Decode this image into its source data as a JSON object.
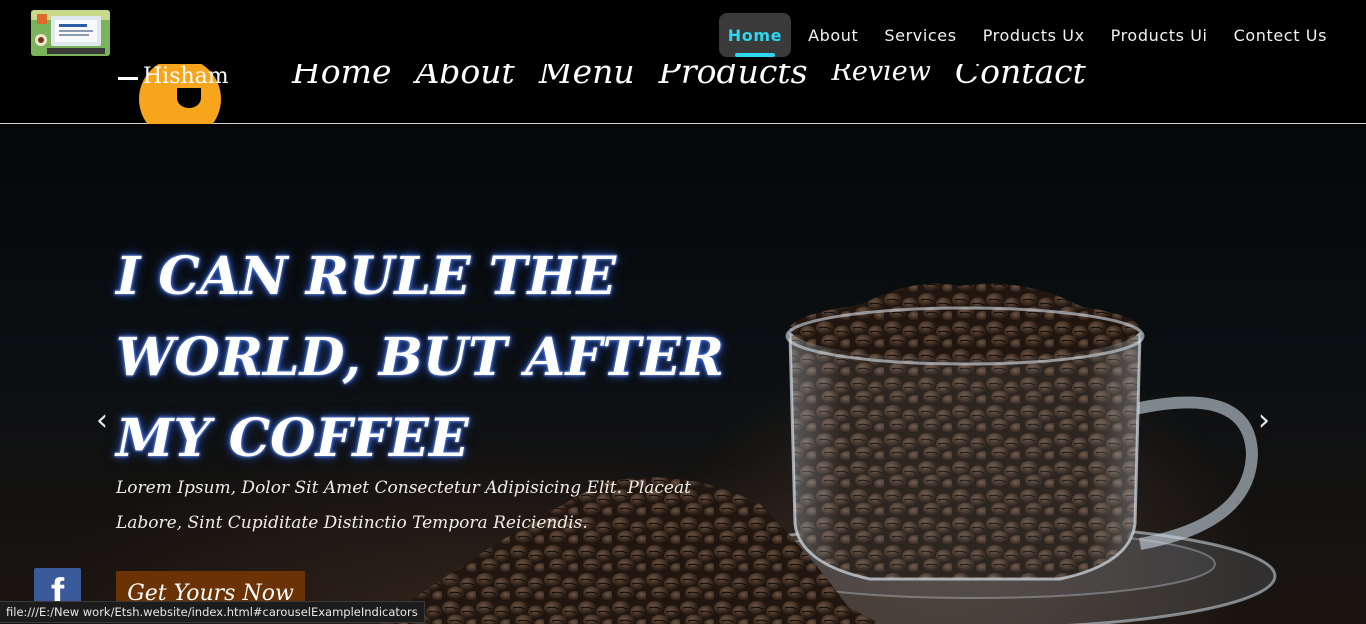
{
  "topbar": {
    "nav": [
      "Home",
      "About",
      "Services",
      "Products Ux",
      "Products Ui",
      "Contect Us"
    ],
    "active_index": 0,
    "accent_color": "#2fd6f0"
  },
  "header": {
    "logo_text": "Hisham",
    "links": [
      "Home",
      "About",
      "Menu",
      "Products",
      "Review",
      "Contact"
    ]
  },
  "hero": {
    "title_lines": [
      "I CAN RULE THE",
      "WORLD, BUT AFTER",
      "MY COFFEE"
    ],
    "text": "Lorem Ipsum, Dolor Sit Amet Consectetur Adipisicing Elit. Placeat Labore, Sint Cupiditate Distinctio Tempora Reiciendis.",
    "cta": "Get Yours Now",
    "prev_icon": "‹",
    "next_icon": "›",
    "button_color": "#6b3206"
  },
  "social": {
    "facebook_icon": "f",
    "color": "#3b5a9a"
  },
  "status_bar": {
    "url": "file:///E:/New work/Etsh.website/index.html#carouselExampleIndicators"
  }
}
